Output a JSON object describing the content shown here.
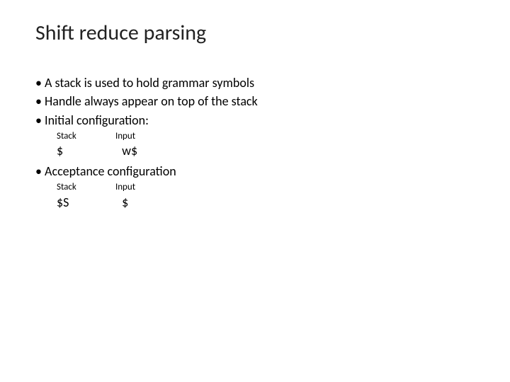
{
  "title": "Shift reduce parsing",
  "bullets": {
    "b1": "A stack is used to hold grammar symbols",
    "b2": "Handle always appear on top of the stack",
    "b3": "Initial configuration:",
    "b4": "Acceptance configuration"
  },
  "headers": {
    "stack": "Stack",
    "input": "Input"
  },
  "initial": {
    "stack": "$",
    "input": "w$"
  },
  "acceptance": {
    "stack": "$S",
    "input": "$"
  }
}
